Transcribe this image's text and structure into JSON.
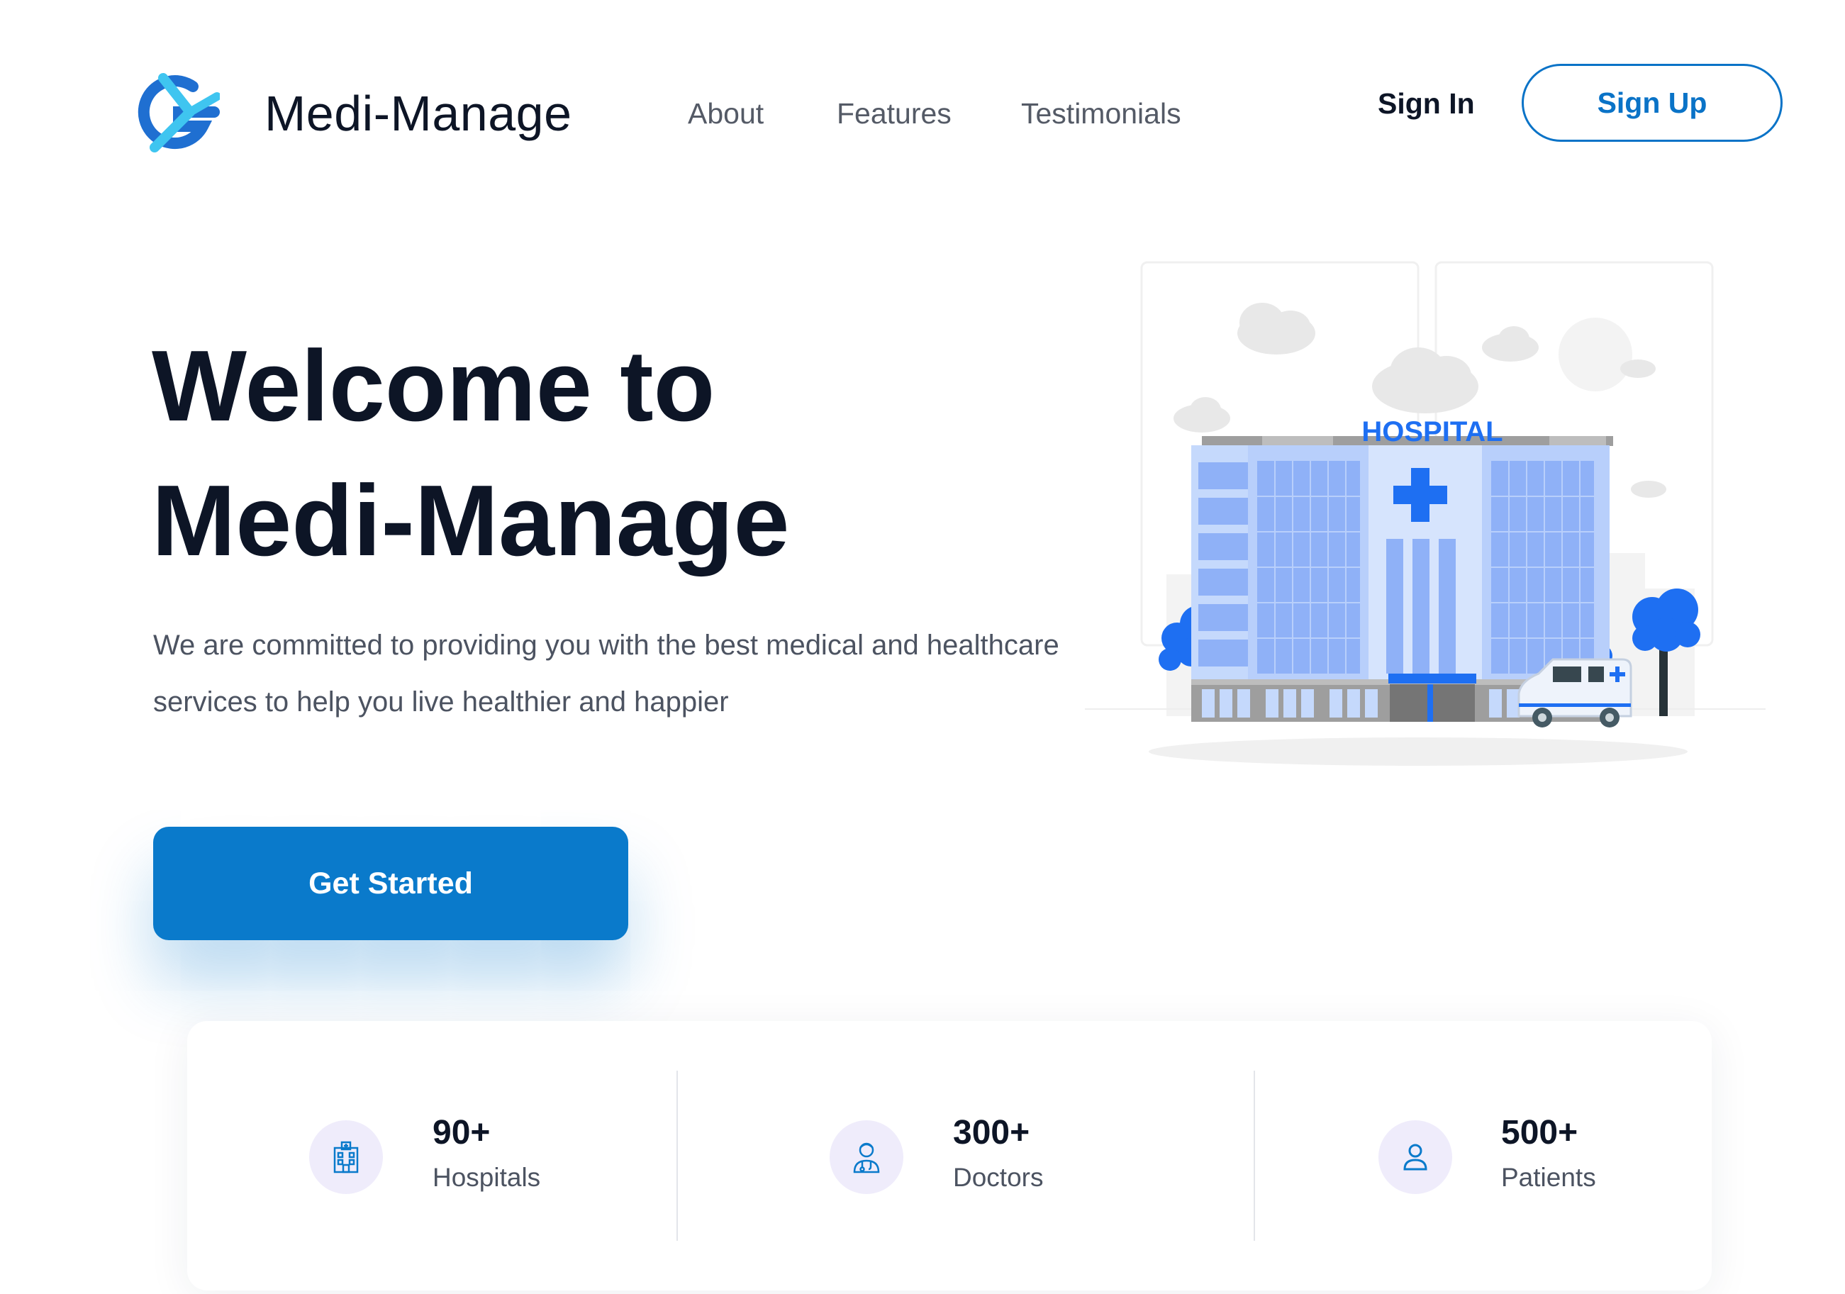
{
  "header": {
    "brand": "Medi-Manage",
    "nav": [
      {
        "label": "About"
      },
      {
        "label": "Features"
      },
      {
        "label": "Testimonials"
      }
    ],
    "sign_in": "Sign In",
    "sign_up": "Sign Up"
  },
  "hero": {
    "title_line1": "Welcome to",
    "title_line2": "Medi-Manage",
    "subtitle": "We are committed to providing you with the best medical and healthcare services to help you live healthier and happier",
    "cta": "Get Started",
    "illustration_sign": "HOSPITAL"
  },
  "stats": [
    {
      "value": "90+",
      "label": "Hospitals",
      "icon": "hospital-icon"
    },
    {
      "value": "300+",
      "label": "Doctors",
      "icon": "doctor-icon"
    },
    {
      "value": "500+",
      "label": "Patients",
      "icon": "user-icon"
    }
  ],
  "colors": {
    "primary": "#0a7acb",
    "text_dark": "#0d1526",
    "text_muted": "#4c5361",
    "icon_bg": "#efecfb",
    "logo_cyan": "#3fc5f0",
    "logo_blue": "#1f6fd1"
  }
}
